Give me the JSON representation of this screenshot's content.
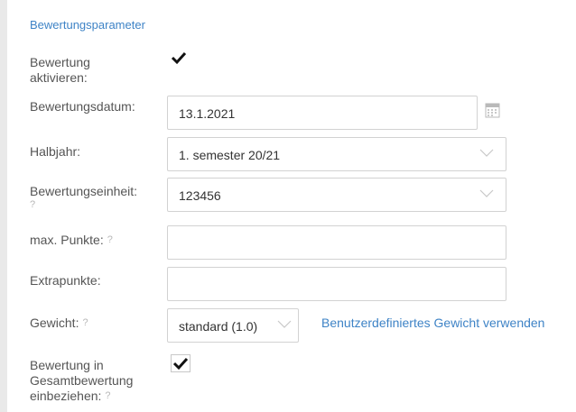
{
  "section_title": "Bewertungsparameter",
  "fields": {
    "enable_grading": {
      "label_line1": "Bewertung",
      "label_line2": "aktivieren:",
      "checked": true
    },
    "date": {
      "label": "Bewertungsdatum:",
      "value": "13.1.2021"
    },
    "half_year": {
      "label": "Halbjahr:",
      "value": "1. semester 20/21"
    },
    "unit": {
      "label": "Bewertungseinheit:",
      "help": "?",
      "value": "123456"
    },
    "max_points": {
      "label": "max. Punkte:",
      "help": "?",
      "value": ""
    },
    "extra_points": {
      "label": "Extrapunkte:",
      "value": ""
    },
    "weight": {
      "label": "Gewicht:",
      "help": "?",
      "value": "standard (1.0)",
      "custom_link": "Benutzerdefiniertes Gewicht verwenden"
    },
    "include_in_total": {
      "label_line1": "Bewertung in",
      "label_line2": "Gesamtbewertung",
      "label_line3": "einbeziehen:",
      "help": "?",
      "checked": true
    }
  },
  "icons": {
    "calendar": "calendar-icon",
    "chevron": "chevron-down-icon",
    "check": "checkmark-icon"
  },
  "colors": {
    "accent": "#3e83c6",
    "label": "#555555",
    "border": "#d2d2d2",
    "help": "#b8b8b8"
  }
}
